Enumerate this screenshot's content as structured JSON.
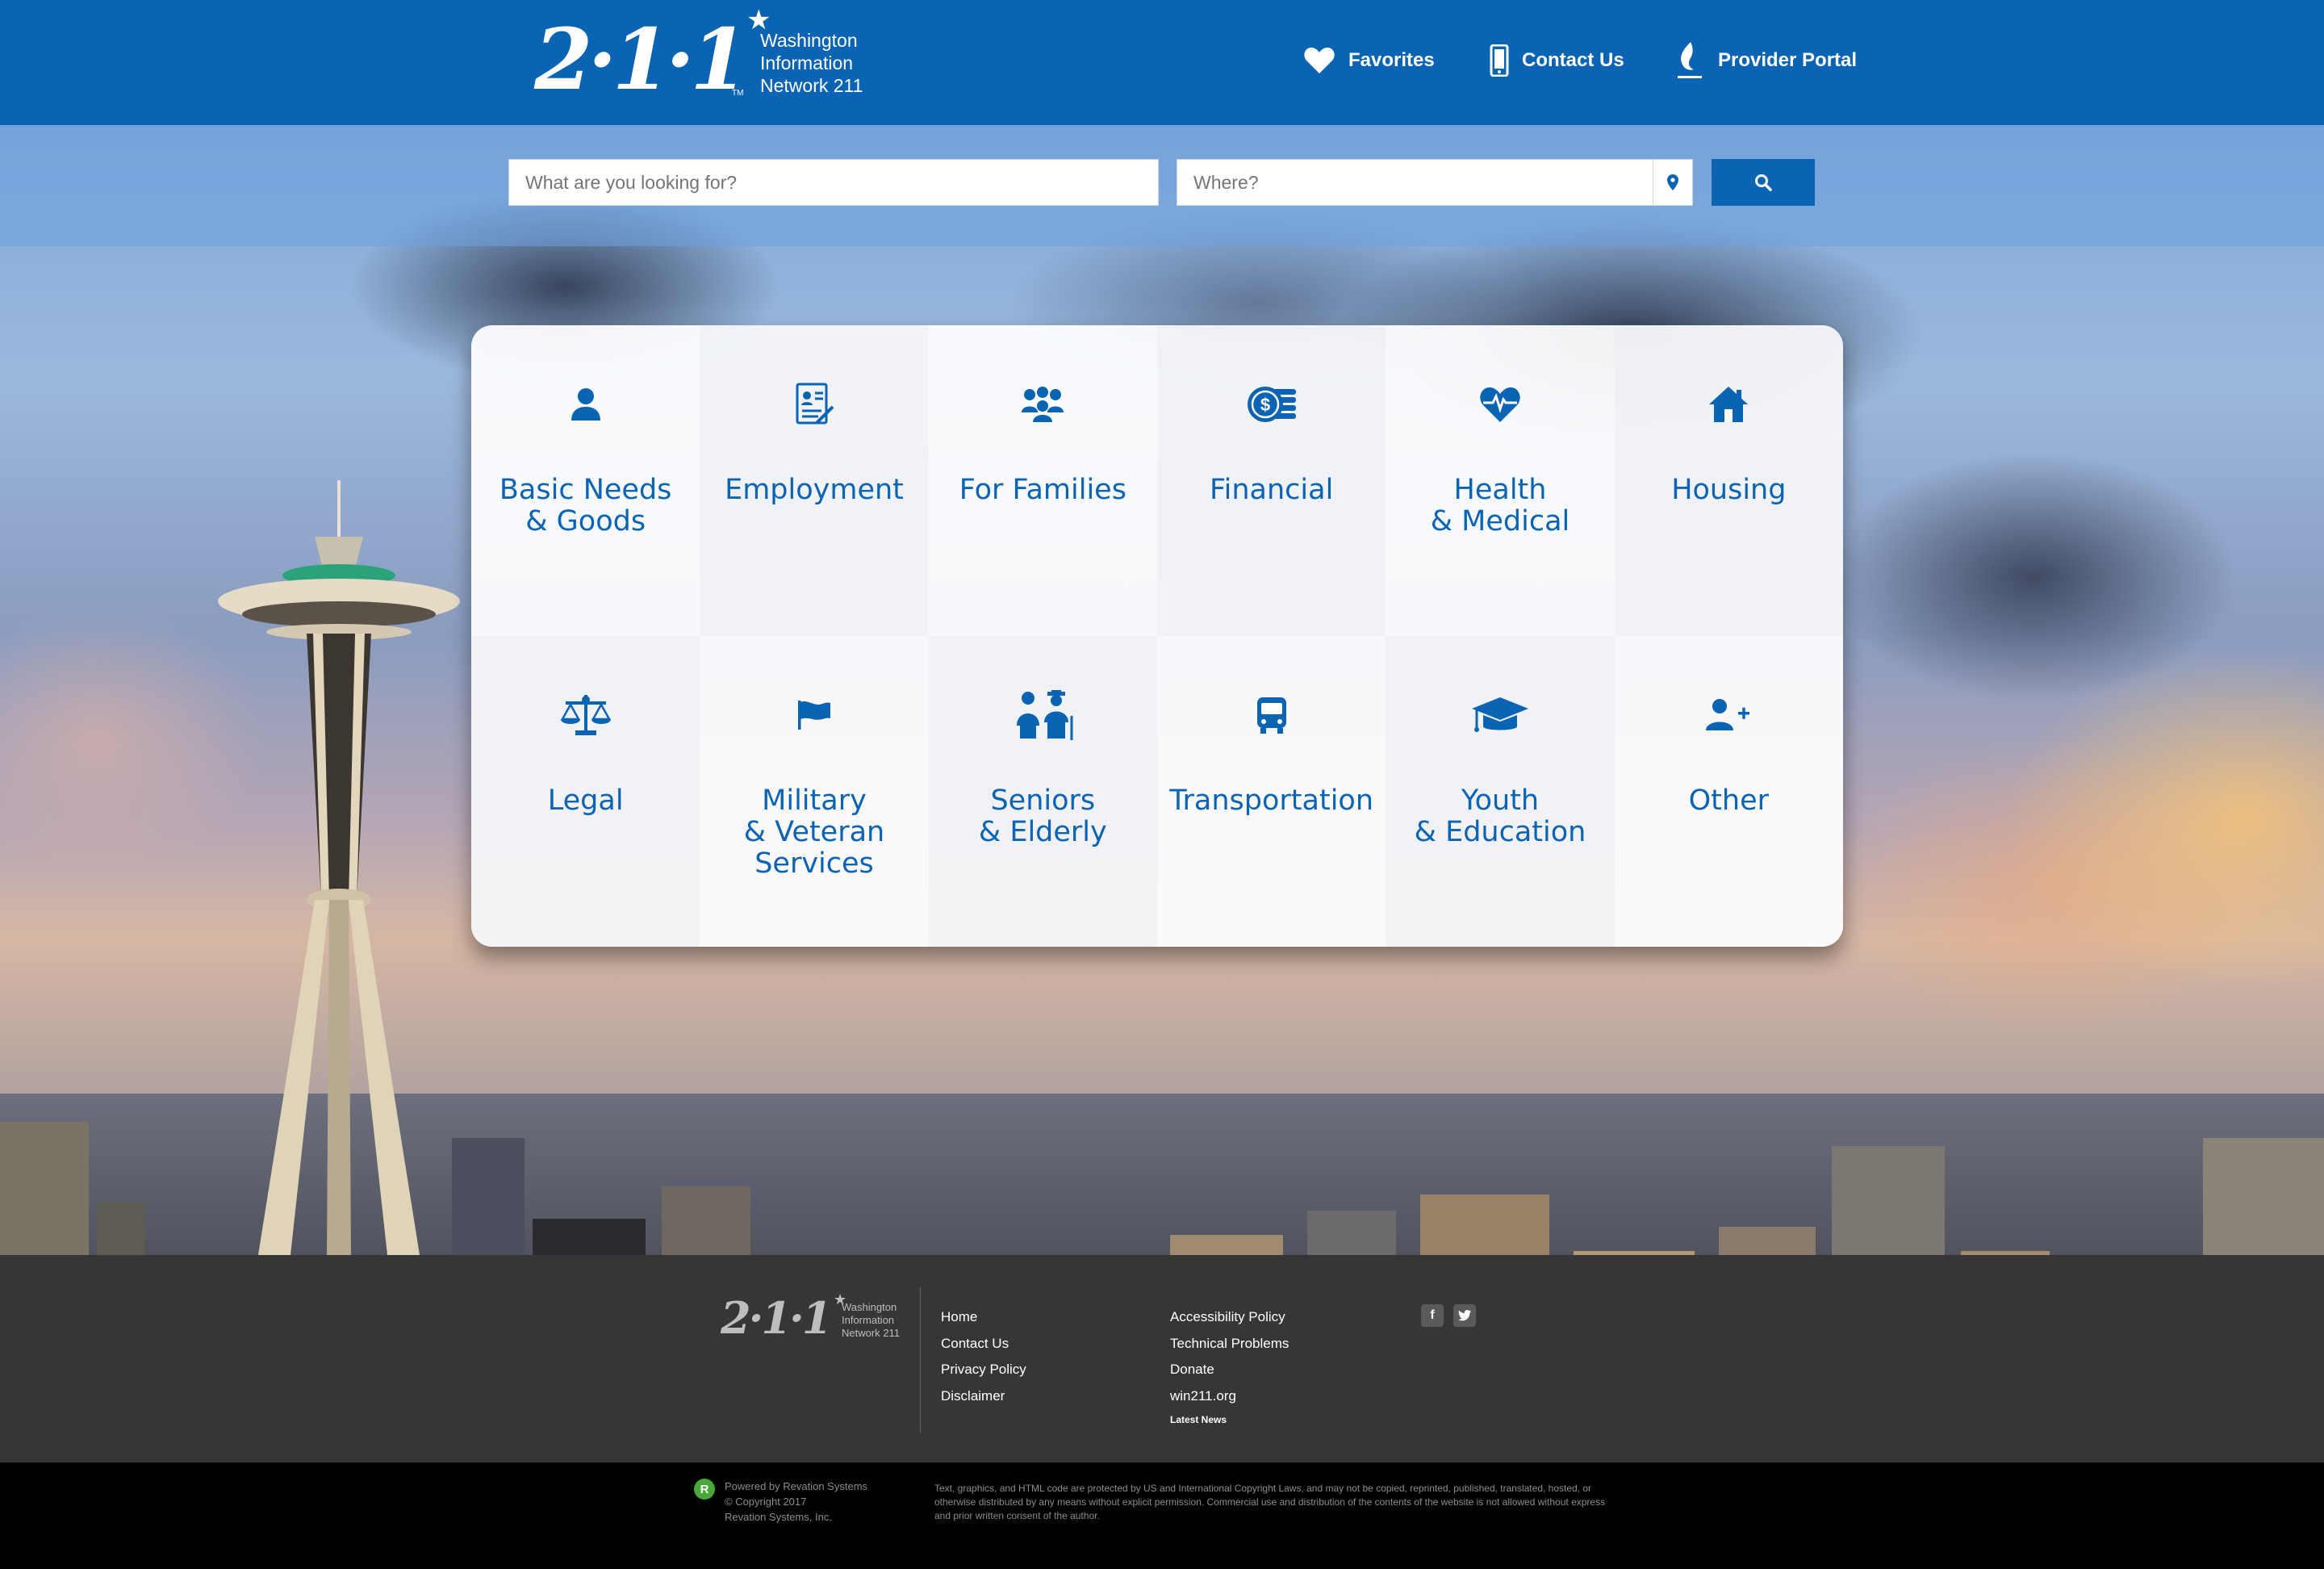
{
  "header": {
    "logo_number": "2·1·1",
    "logo_tm": "TM",
    "logo_lines": [
      "Washington",
      "Information",
      "Network 211"
    ],
    "nav": {
      "favorites": "Favorites",
      "contact": "Contact Us",
      "portal": "Provider Portal"
    },
    "bg_color": "#0a63b3"
  },
  "search": {
    "what_placeholder": "What are you looking for?",
    "where_placeholder": "Where?",
    "what_value": "",
    "where_value": ""
  },
  "categories": [
    {
      "icon": "person-icon",
      "lines": [
        "Basic Needs",
        "& Goods"
      ]
    },
    {
      "icon": "resume-document-icon",
      "lines": [
        "Employment"
      ]
    },
    {
      "icon": "family-group-icon",
      "lines": [
        "For Families"
      ]
    },
    {
      "icon": "coins-dollar-icon",
      "lines": [
        "Financial"
      ]
    },
    {
      "icon": "heart-pulse-icon",
      "lines": [
        "Health",
        "& Medical"
      ]
    },
    {
      "icon": "house-icon",
      "lines": [
        "Housing"
      ]
    },
    {
      "icon": "scales-of-justice-icon",
      "lines": [
        "Legal"
      ]
    },
    {
      "icon": "flag-icon",
      "lines": [
        "Military",
        "& Veteran",
        "Services"
      ]
    },
    {
      "icon": "seniors-couple-icon",
      "lines": [
        "Seniors",
        "& Elderly"
      ]
    },
    {
      "icon": "bus-icon",
      "lines": [
        "Transportation"
      ]
    },
    {
      "icon": "graduation-cap-icon",
      "lines": [
        "Youth",
        "& Education"
      ]
    },
    {
      "icon": "add-user-icon",
      "lines": [
        "Other"
      ]
    }
  ],
  "footer": {
    "logo_number": "2·1·1",
    "logo_lines": [
      "Washington",
      "Information",
      "Network 211"
    ],
    "col1": [
      "Home",
      "Contact Us",
      "Privacy Policy",
      "Disclaimer"
    ],
    "col2": [
      "Accessibility Policy",
      "Technical Problems",
      "Donate",
      "win211.org"
    ],
    "latest_news": "Latest News",
    "social": [
      "facebook-icon",
      "twitter-icon"
    ]
  },
  "bottom": {
    "powered_lines": [
      "Powered by Revation Systems",
      "© Copyright 2017",
      "Revation Systems, Inc."
    ],
    "legal": "Text, graphics, and HTML code are protected by US and International Copyright Laws, and may not be copied, reprinted, published, translated, hosted, or otherwise distributed by any means without explicit permission. Commercial use and distribution of the contents of the website is not allowed without express and prior written consent of the author."
  },
  "colors": {
    "brand_blue": "#0a63b3",
    "footer_bg": "#363636",
    "bottom_bg": "#000000"
  }
}
